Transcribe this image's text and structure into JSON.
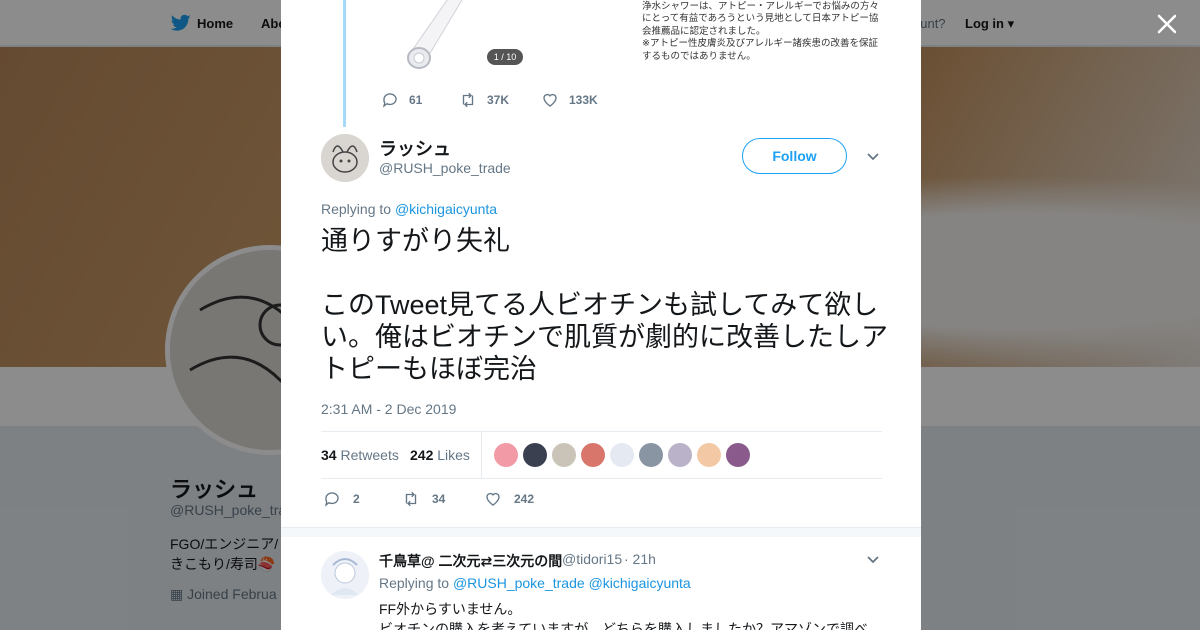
{
  "colors": {
    "accent": "#1da1f2",
    "link": "#1b95e0",
    "muted": "#657786"
  },
  "nav": {
    "home": "Home",
    "about": "Abo",
    "account": "ccount?",
    "login": "Log in"
  },
  "background_profile": {
    "name": "ラッシュ",
    "handle": "@RUSH_poke_tra",
    "bio_line1": "FGO/エンジニア/",
    "bio_line2": "きこもり/寿司",
    "joined": "Joined Februa"
  },
  "quoted_tweet": {
    "image_pager": "1 / 10",
    "product_text": "●日本アトピー協会推薦品\n浄水シャワーは、アトピー・アレルギーでお悩みの方々にとって有益であろうという見地として日本アトピー協会推薦品に認定されました。\n※アトピー性皮膚炎及びアレルギー諸疾患の改善を保証するものではありません。",
    "replies": "61",
    "retweets": "37K",
    "likes": "133K"
  },
  "tweet": {
    "author_name": "ラッシュ",
    "author_handle": "@RUSH_poke_trade",
    "follow_label": "Follow",
    "replying_label": "Replying to",
    "replying_to": "@kichigaicyunta",
    "text": "通りすがり失礼\n\nこのTweet見てる人ビオチンも試してみて欲しい。俺はビオチンで肌質が劇的に改善したしアトピーもほぼ完治",
    "timestamp": "2:31 AM - 2 Dec 2019",
    "retweets_count": "34",
    "retweets_label": "Retweets",
    "likes_count": "242",
    "likes_label": "Likes",
    "liker_colors": [
      "#f29aa6",
      "#3a4050",
      "#c9c3b8",
      "#d9766c",
      "#e5eaf2",
      "#8a95a3",
      "#b9b2c9",
      "#f3c9a5",
      "#8a5a8c"
    ],
    "reply_count": "2",
    "retweet_count": "34",
    "like_count": "242"
  },
  "reply": {
    "name": "千鳥草@ 二次元⇄三次元の間",
    "handle": "@tidori15",
    "time": "· 21h",
    "replying_label": "Replying to",
    "replying_to_1": "@RUSH_poke_trade",
    "replying_to_2": "@kichigaicyunta",
    "text": "FF外からすいません。\nビオチンの購入を考えていますが、どちらを購入しましたか？アマゾンで調べ"
  }
}
